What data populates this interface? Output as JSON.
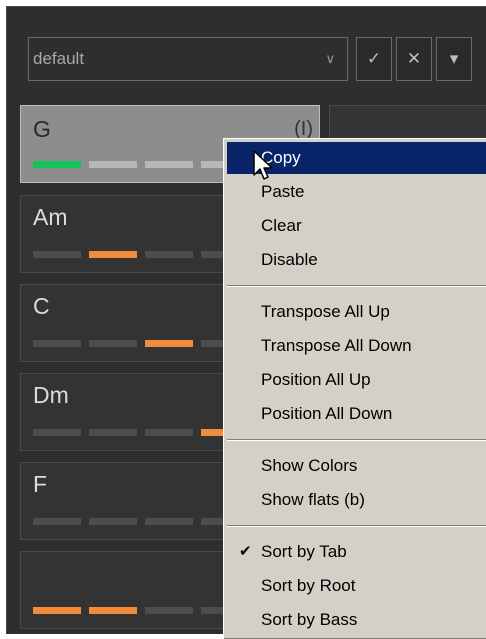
{
  "preset": {
    "value": "default"
  },
  "toolbar": {
    "accept_label": "✓",
    "close_label": "✕",
    "more_label": "▾"
  },
  "chords": [
    {
      "name": "G",
      "tag": "(I)",
      "selected": true,
      "levels": [
        "green",
        "off",
        "off",
        "off",
        "off"
      ]
    },
    {
      "name": "Am",
      "tag": "",
      "selected": false,
      "levels": [
        "off",
        "orange",
        "off",
        "off",
        "off"
      ]
    },
    {
      "name": "C",
      "tag": "",
      "selected": false,
      "levels": [
        "off",
        "off",
        "orange",
        "off",
        "off"
      ]
    },
    {
      "name": "Dm",
      "tag": "",
      "selected": false,
      "levels": [
        "off",
        "off",
        "off",
        "orange",
        "off"
      ]
    },
    {
      "name": "F",
      "tag": "",
      "selected": false,
      "levels": [
        "off",
        "off",
        "off",
        "off",
        "off"
      ]
    },
    {
      "name": "",
      "tag": "",
      "selected": false,
      "levels": [
        "orange",
        "orange",
        "off",
        "off",
        "off"
      ]
    }
  ],
  "context_menu": {
    "items": [
      {
        "label": "Copy"
      },
      {
        "label": "Paste"
      },
      {
        "label": "Clear"
      },
      {
        "label": "Disable"
      },
      {
        "label": "Transpose All Up"
      },
      {
        "label": "Transpose All Down"
      },
      {
        "label": "Position All Up"
      },
      {
        "label": "Position All Down"
      },
      {
        "label": "Show Colors"
      },
      {
        "label": "Show flats (b)"
      },
      {
        "label": "Sort by Tab",
        "checked": true
      },
      {
        "label": "Sort by Root"
      },
      {
        "label": "Sort by Bass"
      }
    ],
    "check_glyph": "✔"
  },
  "colors": {
    "highlight": "#0a246a",
    "active_green": "#16c25a",
    "note_orange": "#f08c3c",
    "menu_bg": "#d4d0c8",
    "app_bg": "#2e2e2e"
  }
}
